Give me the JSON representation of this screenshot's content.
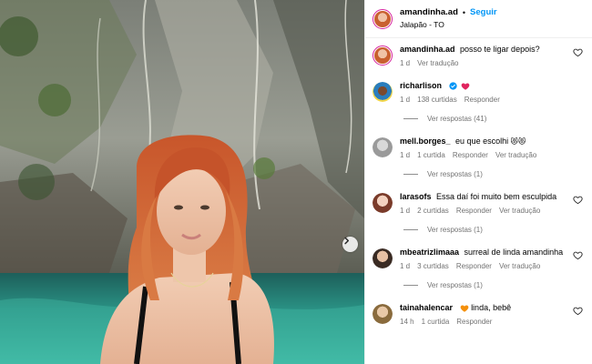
{
  "post": {
    "username": "amandinha.ad",
    "separator": "•",
    "follow_label": "Seguir",
    "location": "Jalapão - TO"
  },
  "caption": {
    "username": "amandinha.ad",
    "text": "posso te ligar depois?",
    "time": "1 d",
    "translate": "Ver tradução"
  },
  "comments": [
    {
      "username": "richarlison",
      "text": "",
      "verified": true,
      "emoji": "red-heart",
      "time": "1 d",
      "likes": "138 curtidas",
      "reply": "Responder",
      "translate": "",
      "view_replies": "Ver respostas (41)"
    },
    {
      "username": "mell.borges_",
      "text": "eu que escolhi",
      "emoji_text": "😻😻",
      "time": "1 d",
      "likes": "1 curtida",
      "reply": "Responder",
      "translate": "Ver tradução",
      "view_replies": "Ver respostas (1)"
    },
    {
      "username": "larasofs",
      "text": "Essa daí foi muito bem esculpida",
      "time": "1 d",
      "likes": "2 curtidas",
      "reply": "Responder",
      "translate": "Ver tradução",
      "view_replies": "Ver respostas (1)"
    },
    {
      "username": "mbeatrizlimaaa",
      "text": "surreal de linda amandinha",
      "time": "1 d",
      "likes": "3 curtidas",
      "reply": "Responder",
      "translate": "Ver tradução",
      "view_replies": "Ver respostas (1)"
    },
    {
      "username": "tainahalencar",
      "text": "linda, bebê",
      "emoji": "orange-heart",
      "time": "14 h",
      "likes": "1 curtida",
      "reply": "Responder",
      "translate": "",
      "view_replies": ""
    }
  ],
  "colors": {
    "link_blue": "#0095f6",
    "meta_gray": "#737373",
    "like_red": "#ed4956"
  },
  "icons": [
    "chevron-right-icon",
    "heart-outline-icon",
    "verified-badge-icon",
    "red-heart-emoji",
    "orange-heart-emoji"
  ]
}
